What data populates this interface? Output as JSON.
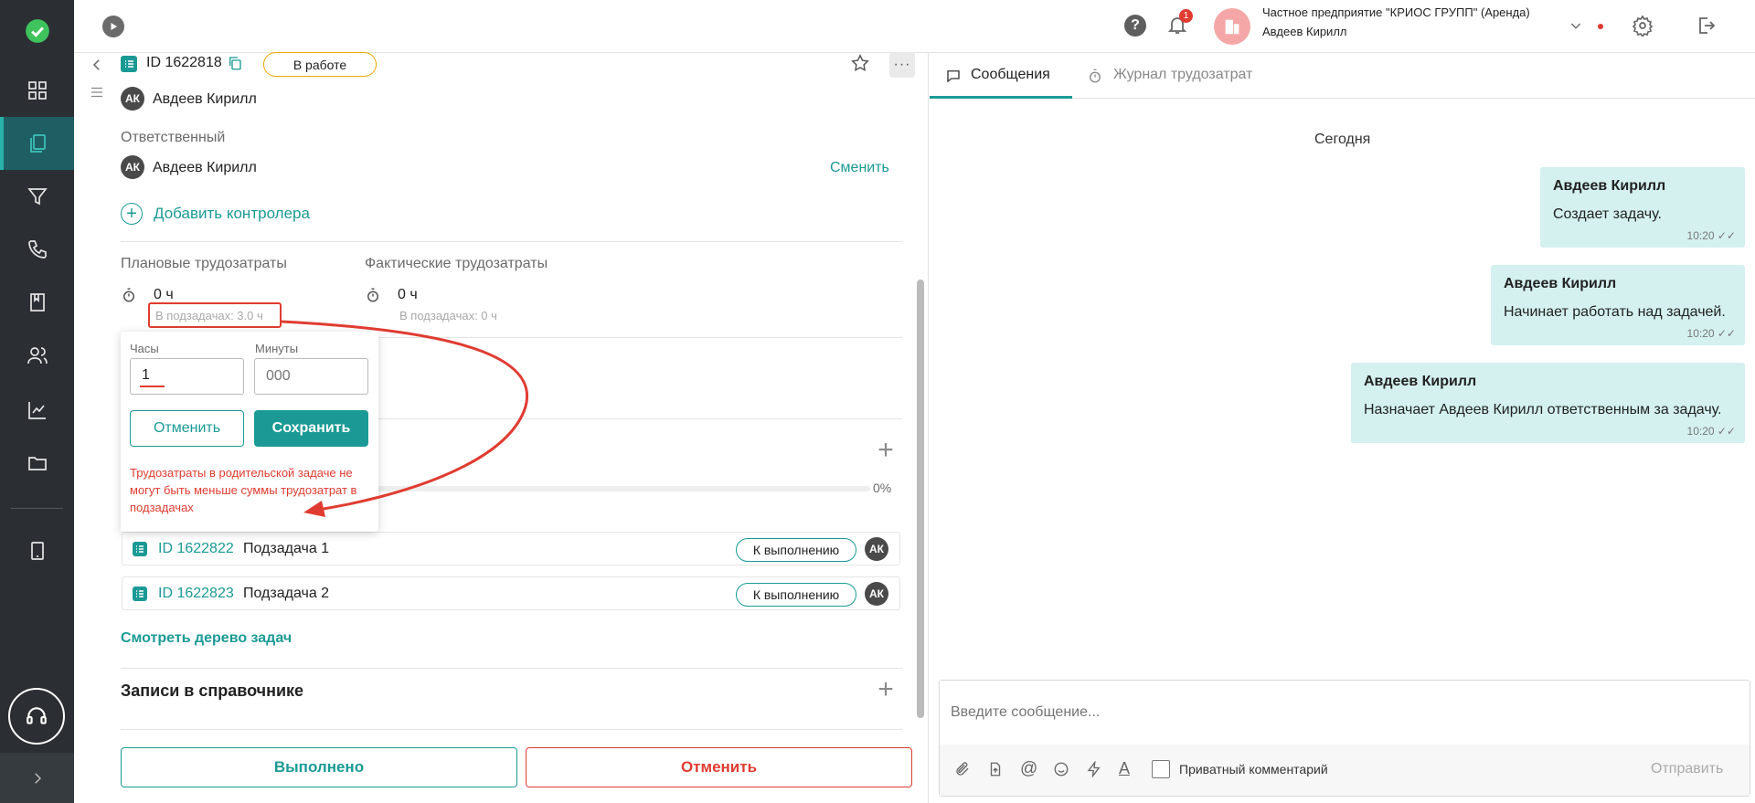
{
  "topbar": {
    "org_name": "Частное предприятие \"КРИОС ГРУПП\" (Аренда)",
    "user_name": "Авдеев Кирилл",
    "notifications_count": "1"
  },
  "task": {
    "id": "ID 1622818",
    "status": "В работе",
    "author_initials": "АК",
    "author": "Авдеев Кирилл",
    "responsible_label": "Ответственный",
    "responsible_initials": "АК",
    "responsible": "Авдеев Кирилл",
    "change_label": "Сменить",
    "add_controller": "Добавить контролера",
    "planned_label": "Плановые трудозатраты",
    "planned_value": "0 ч",
    "planned_sub": "В подзадачах: 3.0 ч",
    "actual_label": "Фактические трудозатраты",
    "actual_value": "0 ч",
    "actual_sub": "В подзадачах: 0 ч",
    "progress": "0%",
    "subtasks": [
      {
        "id": "ID 1622822",
        "name": "Подзадача 1",
        "status": "К выполнению",
        "initials": "АК"
      },
      {
        "id": "ID 1622823",
        "name": "Подзадача 2",
        "status": "К выполнению",
        "initials": "АК"
      }
    ],
    "tree_link": "Смотреть дерево задач",
    "directory_title": "Записи в справочнике",
    "done_button": "Выполнено",
    "cancel_task_button": "Отменить"
  },
  "popup": {
    "hours_label": "Часы",
    "hours_value": "1",
    "minutes_label": "Минуты",
    "minutes_placeholder": "000",
    "cancel": "Отменить",
    "save": "Сохранить",
    "error": "Трудозатраты в родительской задаче не могут быть меньше суммы трудозатрат в подзадачах"
  },
  "right": {
    "tabs": [
      {
        "label": "Сообщения"
      },
      {
        "label": "Журнал трудозатрат"
      }
    ],
    "date": "Сегодня",
    "messages": [
      {
        "author": "Авдеев Кирилл",
        "text": "Создает задачу.",
        "time": "10:20"
      },
      {
        "author": "Авдеев Кирилл",
        "text": "Начинает работать над задачей.",
        "time": "10:20"
      },
      {
        "author": "Авдеев Кирилл",
        "text": "Назначает Авдеев Кирилл ответственным за задачу.",
        "time": "10:20"
      }
    ],
    "input_placeholder": "Введите сообщение...",
    "private_label": "Приватный комментарий",
    "send": "Отправить"
  },
  "colors": {
    "accent": "#1b9a95",
    "sidebar": "#2b2f33",
    "error": "#e03c31",
    "status_border": "#f0a500",
    "message_bg": "#d4f1f0"
  }
}
